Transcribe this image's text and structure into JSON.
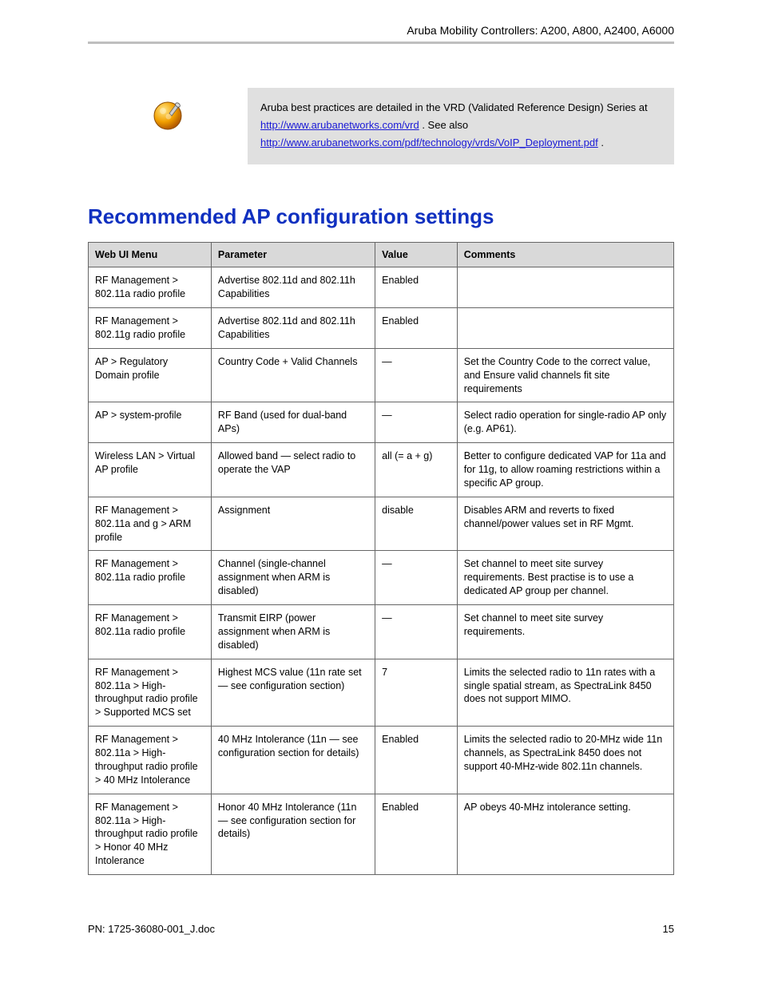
{
  "header": {
    "title": "Aruba Mobility Controllers: A200, A800, A2400, A6000"
  },
  "note": {
    "prefix": "Aruba best practices are detailed in the VRD (Validated Reference Design) Series at ",
    "link1_text": "http://www.arubanetworks.com/vrd",
    "mid": ". See also ",
    "link2_text": "http://www.arubanetworks.com/pdf/technology/vrds/VoIP_Deployment.pdf",
    "suffix": "."
  },
  "section": {
    "title": "Recommended AP configuration settings"
  },
  "table": {
    "headers": {
      "menu": "Web UI Menu",
      "param": "Parameter",
      "value": "Value",
      "comment": "Comments"
    },
    "rows": [
      {
        "menu": "RF Management > 802.11a radio profile",
        "param": "Advertise 802.11d and 802.11h Capabilities",
        "value": "Enabled",
        "comment": ""
      },
      {
        "menu": "RF Management > 802.11g radio profile",
        "param": "Advertise 802.11d and 802.11h Capabilities",
        "value": "Enabled",
        "comment": ""
      },
      {
        "menu": "AP > Regulatory Domain profile",
        "param": "Country Code + Valid Channels",
        "value": "—",
        "comment": "Set the Country Code to the correct value, and Ensure valid channels fit site requirements"
      },
      {
        "menu": "AP > system-profile",
        "param": "RF Band (used for dual-band APs)",
        "value": "—",
        "comment": "Select radio operation for single-radio AP only (e.g. AP61)."
      },
      {
        "menu": "Wireless LAN > Virtual AP profile",
        "param": "Allowed band — select radio to operate the VAP",
        "value": "all (= a + g)",
        "comment": "Better to configure dedicated VAP for 11a and for 11g, to allow roaming restrictions within a specific AP group."
      },
      {
        "menu": "RF Management > 802.11a and g > ARM profile",
        "param": "Assignment",
        "value": "disable",
        "comment": "Disables ARM and reverts to fixed channel/power values set in RF Mgmt."
      },
      {
        "menu": "RF Management > 802.11a radio profile",
        "param": "Channel (single-channel assignment when ARM is disabled)",
        "value": "—",
        "comment": "Set channel to meet site survey requirements. Best practise is to use a dedicated AP group per channel."
      },
      {
        "menu": "RF Management > 802.11a radio profile",
        "param": "Transmit EIRP (power assignment when ARM is disabled)",
        "value": "—",
        "comment": "Set channel to meet site survey requirements."
      },
      {
        "menu": "RF Management > 802.11a > High-throughput radio profile > Supported MCS set",
        "param": "Highest MCS value (11n rate set — see configuration section)",
        "value": "7",
        "comment": "Limits the selected radio to 11n rates with a single spatial stream, as SpectraLink 8450 does not support MIMO."
      },
      {
        "menu": "RF Management > 802.11a > High-throughput radio profile > 40 MHz Intolerance",
        "param": "40 MHz Intolerance (11n — see configuration section for details)",
        "value": "Enabled",
        "comment": "Limits the selected radio to 20-MHz wide 11n channels, as SpectraLink 8450 does not support 40-MHz-wide 802.11n channels."
      },
      {
        "menu": "RF Management > 802.11a > High-throughput radio profile > Honor 40 MHz Intolerance",
        "param": "Honor 40 MHz Intolerance (11n — see configuration section for details)",
        "value": "Enabled",
        "comment": "AP obeys 40-MHz intolerance setting."
      }
    ]
  },
  "footer": {
    "left": "PN: 1725-36080-001_J.doc",
    "right": "15"
  }
}
